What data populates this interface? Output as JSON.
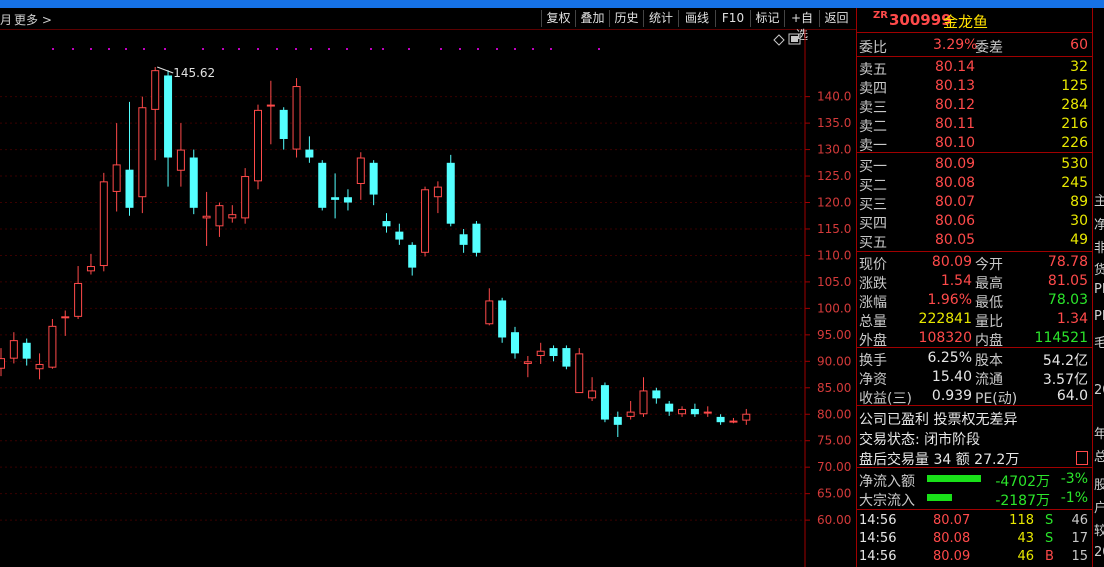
{
  "toolbar": {
    "left_label": "月",
    "more_label": "更多",
    "buttons": [
      "复权",
      "叠加",
      "历史",
      "统计",
      "画线",
      "F10",
      "标记",
      "+自选",
      "返回"
    ]
  },
  "quote": {
    "tag": "ZR",
    "code": "300999",
    "name": "金龙鱼",
    "committee_ratio_label": "委比",
    "committee_ratio": "3.29%",
    "committee_diff_label": "委差",
    "committee_diff": "60",
    "asks": [
      {
        "label": "卖五",
        "price": "80.14",
        "vol": "32"
      },
      {
        "label": "卖四",
        "price": "80.13",
        "vol": "125"
      },
      {
        "label": "卖三",
        "price": "80.12",
        "vol": "284"
      },
      {
        "label": "卖二",
        "price": "80.11",
        "vol": "216"
      },
      {
        "label": "卖一",
        "price": "80.10",
        "vol": "226"
      }
    ],
    "bids": [
      {
        "label": "买一",
        "price": "80.09",
        "vol": "530"
      },
      {
        "label": "买二",
        "price": "80.08",
        "vol": "245"
      },
      {
        "label": "买三",
        "price": "80.07",
        "vol": "89"
      },
      {
        "label": "买四",
        "price": "80.06",
        "vol": "30"
      },
      {
        "label": "买五",
        "price": "80.05",
        "vol": "49"
      }
    ],
    "stats": [
      {
        "l1": "现价",
        "v1": "80.09",
        "l2": "今开",
        "v2": "78.78",
        "c1": "red",
        "c2": "red"
      },
      {
        "l1": "涨跌",
        "v1": "1.54",
        "l2": "最高",
        "v2": "81.05",
        "c1": "red",
        "c2": "red"
      },
      {
        "l1": "涨幅",
        "v1": "1.96%",
        "l2": "最低",
        "v2": "78.03",
        "c1": "red",
        "c2": "green"
      },
      {
        "l1": "总量",
        "v1": "222841",
        "l2": "量比",
        "v2": "1.34",
        "c1": "yellow",
        "c2": "red"
      },
      {
        "l1": "外盘",
        "v1": "108320",
        "l2": "内盘",
        "v2": "114521",
        "c1": "red",
        "c2": "green"
      }
    ],
    "stats2": [
      {
        "l1": "换手",
        "v1": "6.25%",
        "l2": "股本",
        "v2": "54.2亿"
      },
      {
        "l1": "净资",
        "v1": "15.40",
        "l2": "流通",
        "v2": "3.57亿"
      },
      {
        "l1": "收益(三)",
        "v1": "0.939",
        "l2": "PE(动)",
        "v2": "64.0"
      }
    ],
    "notes": [
      "公司已盈利 投票权无差异",
      "交易状态: 闭市阶段",
      "盘后交易量 34 额 27.2万"
    ],
    "flows": [
      {
        "label": "净流入额",
        "value": "-4702万",
        "pct": "-3%",
        "bar": 1.0
      },
      {
        "label": "大宗流入",
        "value": "-2187万",
        "pct": "-1%",
        "bar": 0.47
      }
    ],
    "ticks": [
      {
        "time": "14:56",
        "price": "80.07",
        "vol": "118",
        "side": "S",
        "n": "46"
      },
      {
        "time": "14:56",
        "price": "80.08",
        "vol": "43",
        "side": "S",
        "n": "17"
      },
      {
        "time": "14:56",
        "price": "80.09",
        "vol": "46",
        "side": "B",
        "n": "15"
      }
    ]
  },
  "right_strip": [
    "主",
    "净",
    "非",
    "货",
    "PI",
    "PI",
    "毛",
    "20",
    "年",
    "总",
    "股",
    "户",
    "较",
    "20"
  ],
  "colors": {
    "up": "#ff4a4a",
    "down": "#54ffff",
    "axis": "#a00000",
    "marker": "#c000c0"
  },
  "chart_data": {
    "type": "candlestick",
    "ylim": [
      57,
      149
    ],
    "y_ticks": [
      "140.0",
      "135.0",
      "130.0",
      "125.0",
      "120.0",
      "115.0",
      "110.0",
      "105.0",
      "100.0",
      "95.00",
      "90.00",
      "85.00",
      "80.00",
      "75.00",
      "70.00",
      "65.00",
      "60.00"
    ],
    "y_tick_values": [
      140,
      135,
      130,
      125,
      120,
      115,
      110,
      105,
      100,
      95,
      90,
      85,
      80,
      75,
      70,
      65,
      60
    ],
    "max_annotation": "145.62",
    "candles": [
      {
        "o": 88.6,
        "c": 90.6,
        "h": 92.5,
        "l": 87.2
      },
      {
        "o": 90.5,
        "c": 94.0,
        "h": 95.5,
        "l": 89.6
      },
      {
        "o": 93.5,
        "c": 90.5,
        "h": 94.3,
        "l": 89.2
      },
      {
        "o": 88.5,
        "c": 89.5,
        "h": 91.5,
        "l": 86.6
      },
      {
        "o": 88.8,
        "c": 96.7,
        "h": 98.0,
        "l": 88.6
      },
      {
        "o": 98.5,
        "c": 98.5,
        "h": 99.6,
        "l": 94.8
      },
      {
        "o": 98.4,
        "c": 104.8,
        "h": 108.0,
        "l": 98.0
      },
      {
        "o": 107.0,
        "c": 108.0,
        "h": 110.3,
        "l": 106.4
      },
      {
        "o": 108.0,
        "c": 124.0,
        "h": 125.6,
        "l": 107.0
      },
      {
        "o": 122.0,
        "c": 127.2,
        "h": 135.0,
        "l": 118.3
      },
      {
        "o": 126.2,
        "c": 119.0,
        "h": 139.0,
        "l": 117.5
      },
      {
        "o": 121.0,
        "c": 138.0,
        "h": 140.0,
        "l": 118.0
      },
      {
        "o": 137.5,
        "c": 145.0,
        "h": 145.6,
        "l": 128.0
      },
      {
        "o": 144.0,
        "c": 128.5,
        "h": 145.0,
        "l": 123.0
      },
      {
        "o": 126.0,
        "c": 130.0,
        "h": 135.0,
        "l": 123.0
      },
      {
        "o": 128.5,
        "c": 119.0,
        "h": 130.0,
        "l": 117.8
      },
      {
        "o": 117.0,
        "c": 117.5,
        "h": 122.0,
        "l": 111.8
      },
      {
        "o": 115.5,
        "c": 119.5,
        "h": 120.0,
        "l": 113.5
      },
      {
        "o": 117.0,
        "c": 117.8,
        "h": 119.5,
        "l": 116.2
      },
      {
        "o": 117.0,
        "c": 125.0,
        "h": 126.5,
        "l": 116.0
      },
      {
        "o": 124.0,
        "c": 137.5,
        "h": 138.5,
        "l": 122.5
      },
      {
        "o": 138.5,
        "c": 138.5,
        "h": 143.0,
        "l": 131.0
      },
      {
        "o": 137.5,
        "c": 132.0,
        "h": 138.0,
        "l": 130.0
      },
      {
        "o": 130.0,
        "c": 142.0,
        "h": 143.5,
        "l": 128.5
      },
      {
        "o": 130.0,
        "c": 128.5,
        "h": 132.5,
        "l": 127.5
      },
      {
        "o": 127.5,
        "c": 119.0,
        "h": 128.0,
        "l": 118.5
      },
      {
        "o": 121.0,
        "c": 120.5,
        "h": 125.5,
        "l": 117.0
      },
      {
        "o": 121.0,
        "c": 120.0,
        "h": 122.5,
        "l": 118.5
      },
      {
        "o": 123.5,
        "c": 128.5,
        "h": 129.5,
        "l": 120.5
      },
      {
        "o": 127.5,
        "c": 121.5,
        "h": 128.0,
        "l": 119.5
      },
      {
        "o": 116.5,
        "c": 115.5,
        "h": 118.0,
        "l": 114.3
      },
      {
        "o": 114.5,
        "c": 113.0,
        "h": 116.0,
        "l": 112.0
      },
      {
        "o": 112.0,
        "c": 107.7,
        "h": 112.5,
        "l": 106.2
      },
      {
        "o": 110.5,
        "c": 122.5,
        "h": 123.0,
        "l": 109.8
      },
      {
        "o": 121.0,
        "c": 123.0,
        "h": 124.0,
        "l": 118.0
      },
      {
        "o": 127.5,
        "c": 116.0,
        "h": 129.0,
        "l": 115.5
      },
      {
        "o": 114.0,
        "c": 112.0,
        "h": 115.0,
        "l": 110.5
      },
      {
        "o": 116.0,
        "c": 110.5,
        "h": 116.5,
        "l": 109.8
      },
      {
        "o": 97.0,
        "c": 101.5,
        "h": 103.8,
        "l": 96.8
      },
      {
        "o": 101.5,
        "c": 94.5,
        "h": 102.0,
        "l": 93.5
      },
      {
        "o": 95.5,
        "c": 91.5,
        "h": 96.5,
        "l": 90.5
      },
      {
        "o": 89.5,
        "c": 90.0,
        "h": 91.0,
        "l": 87.0
      },
      {
        "o": 91.0,
        "c": 92.0,
        "h": 93.5,
        "l": 89.5
      },
      {
        "o": 92.5,
        "c": 91.0,
        "h": 93.0,
        "l": 90.0
      },
      {
        "o": 92.5,
        "c": 89.0,
        "h": 93.0,
        "l": 88.5
      },
      {
        "o": 84.0,
        "c": 91.5,
        "h": 92.5,
        "l": 87.0
      },
      {
        "o": 83.0,
        "c": 84.5,
        "h": 87.0,
        "l": 82.5
      },
      {
        "o": 85.5,
        "c": 79.0,
        "h": 86.0,
        "l": 78.5
      },
      {
        "o": 79.5,
        "c": 78.0,
        "h": 80.5,
        "l": 75.7
      },
      {
        "o": 79.5,
        "c": 80.5,
        "h": 82.5,
        "l": 79.0
      },
      {
        "o": 80.0,
        "c": 84.5,
        "h": 87.0,
        "l": 79.5
      },
      {
        "o": 84.5,
        "c": 83.0,
        "h": 85.0,
        "l": 82.0
      },
      {
        "o": 82.0,
        "c": 80.5,
        "h": 82.5,
        "l": 79.7
      },
      {
        "o": 80.0,
        "c": 81.0,
        "h": 81.5,
        "l": 79.5
      },
      {
        "o": 81.0,
        "c": 80.0,
        "h": 82.0,
        "l": 79.5
      },
      {
        "o": 80.5,
        "c": 80.5,
        "h": 81.5,
        "l": 79.5
      },
      {
        "o": 79.5,
        "c": 78.5,
        "h": 80.0,
        "l": 78.0
      },
      {
        "o": 78.7,
        "c": 78.8,
        "h": 79.3,
        "l": 78.3
      },
      {
        "o": 78.8,
        "c": 80.1,
        "h": 81.0,
        "l": 78.0
      }
    ]
  }
}
